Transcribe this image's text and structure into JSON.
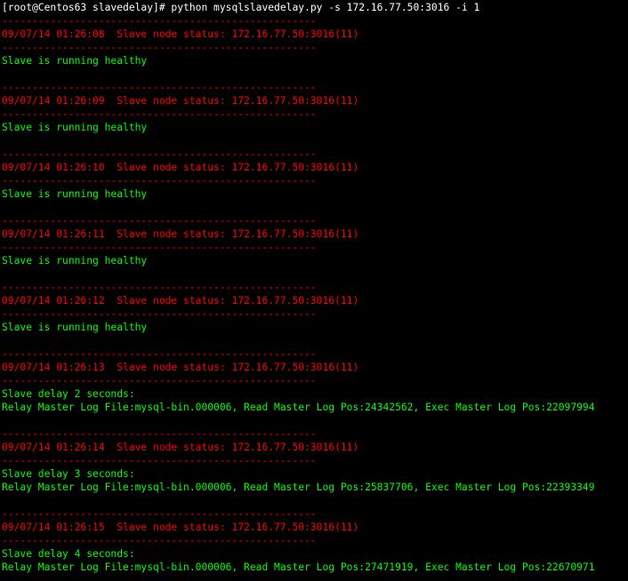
{
  "terminal": {
    "background": "#000000",
    "colors": {
      "prompt": "#ffffff",
      "status": "#ff0000",
      "healthy": "#00ff00"
    },
    "lines": [
      {
        "kind": "cmd",
        "text": "[root@Centos63 slavedelay]# python mysqlslavedelay.py -s 172.16.77.50:3016 -i 1"
      },
      {
        "kind": "sep",
        "text": "----------------------------------------------------"
      },
      {
        "kind": "status",
        "text": "09/07/14 01:26:08  Slave node status: 172.16.77.50:3016(11)"
      },
      {
        "kind": "sep",
        "text": "----------------------------------------------------"
      },
      {
        "kind": "ok",
        "text": "Slave is running healthy"
      },
      {
        "kind": "blank",
        "text": ""
      },
      {
        "kind": "sep",
        "text": "----------------------------------------------------"
      },
      {
        "kind": "status",
        "text": "09/07/14 01:26:09  Slave node status: 172.16.77.50:3016(11)"
      },
      {
        "kind": "sep",
        "text": "----------------------------------------------------"
      },
      {
        "kind": "ok",
        "text": "Slave is running healthy"
      },
      {
        "kind": "blank",
        "text": ""
      },
      {
        "kind": "sep",
        "text": "----------------------------------------------------"
      },
      {
        "kind": "status",
        "text": "09/07/14 01:26:10  Slave node status: 172.16.77.50:3016(11)"
      },
      {
        "kind": "sep",
        "text": "----------------------------------------------------"
      },
      {
        "kind": "ok",
        "text": "Slave is running healthy"
      },
      {
        "kind": "blank",
        "text": ""
      },
      {
        "kind": "sep",
        "text": "----------------------------------------------------"
      },
      {
        "kind": "status",
        "text": "09/07/14 01:26:11  Slave node status: 172.16.77.50:3016(11)"
      },
      {
        "kind": "sep",
        "text": "----------------------------------------------------"
      },
      {
        "kind": "ok",
        "text": "Slave is running healthy"
      },
      {
        "kind": "blank",
        "text": ""
      },
      {
        "kind": "sep",
        "text": "----------------------------------------------------"
      },
      {
        "kind": "status",
        "text": "09/07/14 01:26:12  Slave node status: 172.16.77.50:3016(11)"
      },
      {
        "kind": "sep",
        "text": "----------------------------------------------------"
      },
      {
        "kind": "ok",
        "text": "Slave is running healthy"
      },
      {
        "kind": "blank",
        "text": ""
      },
      {
        "kind": "sep",
        "text": "----------------------------------------------------"
      },
      {
        "kind": "status",
        "text": "09/07/14 01:26:13  Slave node status: 172.16.77.50:3016(11)"
      },
      {
        "kind": "sep",
        "text": "----------------------------------------------------"
      },
      {
        "kind": "ok",
        "text": "Slave delay 2 seconds:"
      },
      {
        "kind": "ok",
        "text": "Relay Master Log File:mysql-bin.000006, Read Master Log Pos:24342562, Exec Master Log Pos:22097994"
      },
      {
        "kind": "blank",
        "text": ""
      },
      {
        "kind": "sep",
        "text": "----------------------------------------------------"
      },
      {
        "kind": "status",
        "text": "09/07/14 01:26:14  Slave node status: 172.16.77.50:3016(11)"
      },
      {
        "kind": "sep",
        "text": "----------------------------------------------------"
      },
      {
        "kind": "ok",
        "text": "Slave delay 3 seconds:"
      },
      {
        "kind": "ok",
        "text": "Relay Master Log File:mysql-bin.000006, Read Master Log Pos:25837706, Exec Master Log Pos:22393349"
      },
      {
        "kind": "blank",
        "text": ""
      },
      {
        "kind": "sep",
        "text": "----------------------------------------------------"
      },
      {
        "kind": "status",
        "text": "09/07/14 01:26:15  Slave node status: 172.16.77.50:3016(11)"
      },
      {
        "kind": "sep",
        "text": "----------------------------------------------------"
      },
      {
        "kind": "ok",
        "text": "Slave delay 4 seconds:"
      },
      {
        "kind": "ok",
        "text": "Relay Master Log File:mysql-bin.000006, Read Master Log Pos:27471919, Exec Master Log Pos:22670971"
      }
    ]
  }
}
